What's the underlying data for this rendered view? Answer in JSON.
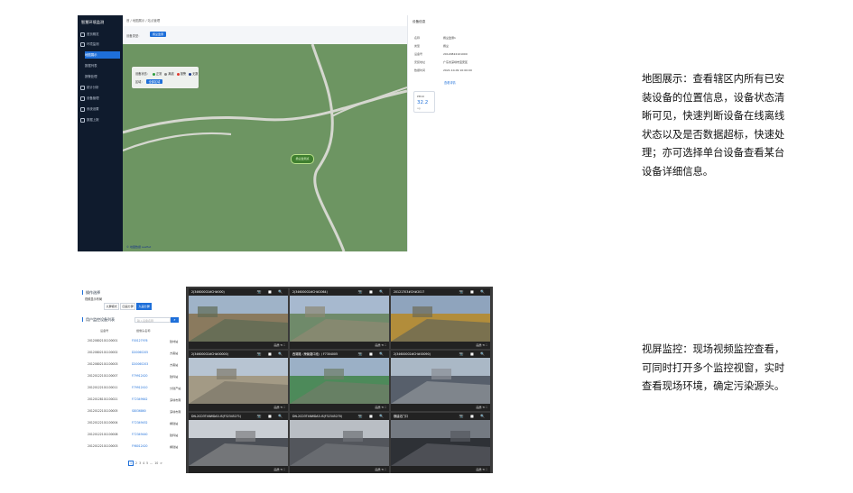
{
  "map_screen": {
    "app_title": "智慧环境监测",
    "sidebar": {
      "items": [
        {
          "label": "首页概览"
        },
        {
          "label": "环境监测"
        },
        {
          "label": "地图展示"
        },
        {
          "label": "数据列表"
        },
        {
          "label": "报警处理"
        },
        {
          "label": "统计分析"
        },
        {
          "label": "设备管理"
        },
        {
          "label": "系统设置"
        },
        {
          "label": "数据上报"
        }
      ]
    },
    "breadcrumb": "首 / 地图展示 / 站点管理",
    "filter": {
      "label": "设备类型：",
      "value": "扬尘监测"
    },
    "legend": {
      "prefix": "设备状态：",
      "states": [
        {
          "label": "正常",
          "color": "#2e9e3e"
        },
        {
          "label": "离线",
          "color": "#8a8a8a"
        },
        {
          "label": "报警",
          "color": "#e03a2f"
        },
        {
          "label": "无数",
          "color": "#1e3a8a"
        }
      ],
      "row2_label": "区域：",
      "row2_button": "全部区域"
    },
    "marker_label": "扬尘监测点",
    "map_footer": "© 地图数据 Leaflet",
    "info_panel": {
      "title": "设备信息",
      "fields": [
        {
          "key": "名称",
          "value": "扬尘监测1"
        },
        {
          "key": "类型",
          "value": "扬尘"
        },
        {
          "key": "设备号",
          "value": "20120822101000"
        },
        {
          "key": "安装地址",
          "value": "广东省深圳市宝安区"
        },
        {
          "key": "数据时间",
          "value": "2021-10-09 10:00:00"
        }
      ],
      "detail_link": "查看详情",
      "pm_card": {
        "label": "PM10",
        "value": "32.2",
        "unit": "ug"
      }
    }
  },
  "video_screen": {
    "section1_title": "操作选择",
    "display_label": "视频显示布局",
    "tabs": [
      {
        "label": "大屏模式",
        "active": false
      },
      {
        "label": "四画分屏",
        "active": false
      },
      {
        "label": "九画分屏",
        "active": true
      }
    ],
    "section2_title": "用户监控设备列表",
    "search_placeholder": "输入设备名称",
    "columns": [
      "设备号",
      "摄像头名称",
      ""
    ],
    "rows": [
      {
        "id": "20120802101100001",
        "cam": "F00127976",
        "site": "建材站"
      },
      {
        "id": "20120802101100002",
        "cam": "D20060205",
        "site": "方案站"
      },
      {
        "id": "20120802101100003",
        "cam": "D20060203",
        "site": "方案站"
      },
      {
        "id": "20120122101100007",
        "cam": "F79912420",
        "site": "建科站"
      },
      {
        "id": "20120122101100011",
        "cam": "F79912410",
        "site": "分建产站"
      },
      {
        "id": "20120128101100021",
        "cam": "F72349642",
        "site": "深圳市南"
      },
      {
        "id": "20120122101100005",
        "cam": "S8036860",
        "site": "深圳市南"
      },
      {
        "id": "20120122101100004",
        "cam": "F72349452",
        "site": "横建站"
      },
      {
        "id": "20120122101100008",
        "cam": "F72349440",
        "site": "建科站"
      },
      {
        "id": "20120122101100003",
        "cam": "F98012420",
        "site": "横建站"
      }
    ],
    "pager": [
      "1",
      "2",
      "3",
      "4",
      "5",
      "...",
      "10",
      ">"
    ],
    "video_icons": "📷 ■ 🔍",
    "video_footer": "画质 ⟲ ⛶",
    "cells": [
      {
        "title": "2(34600002#CH#000)"
      },
      {
        "title": "2(34600002#CH#2064)"
      },
      {
        "title": "20121703#CH#2017"
      },
      {
        "title": "2(34600002#CH#00000)"
      },
      {
        "title": "西湖路（荣聚路口段）/ F7304005"
      },
      {
        "title": "2(34600002#CH#00090)"
      },
      {
        "title": "DN-2CD3T46WDA3-IS(F32345271)"
      },
      {
        "title": "DN-2CD3T46WDA3-IS(F32345270)"
      },
      {
        "title": "横建站门口"
      }
    ]
  },
  "descriptions": {
    "map": "地图展示：查看辖区内所有已安装设备的位置信息，设备状态清晰可见，快速判断设备在线离线状态以及是否数据超标，快速处理；亦可选择单台设备查看某台设备详细信息。",
    "video": "视屏监控：现场视频监控查看，可同时打开多个监控视窗，实时查看现场环境，确定污染源头。"
  }
}
